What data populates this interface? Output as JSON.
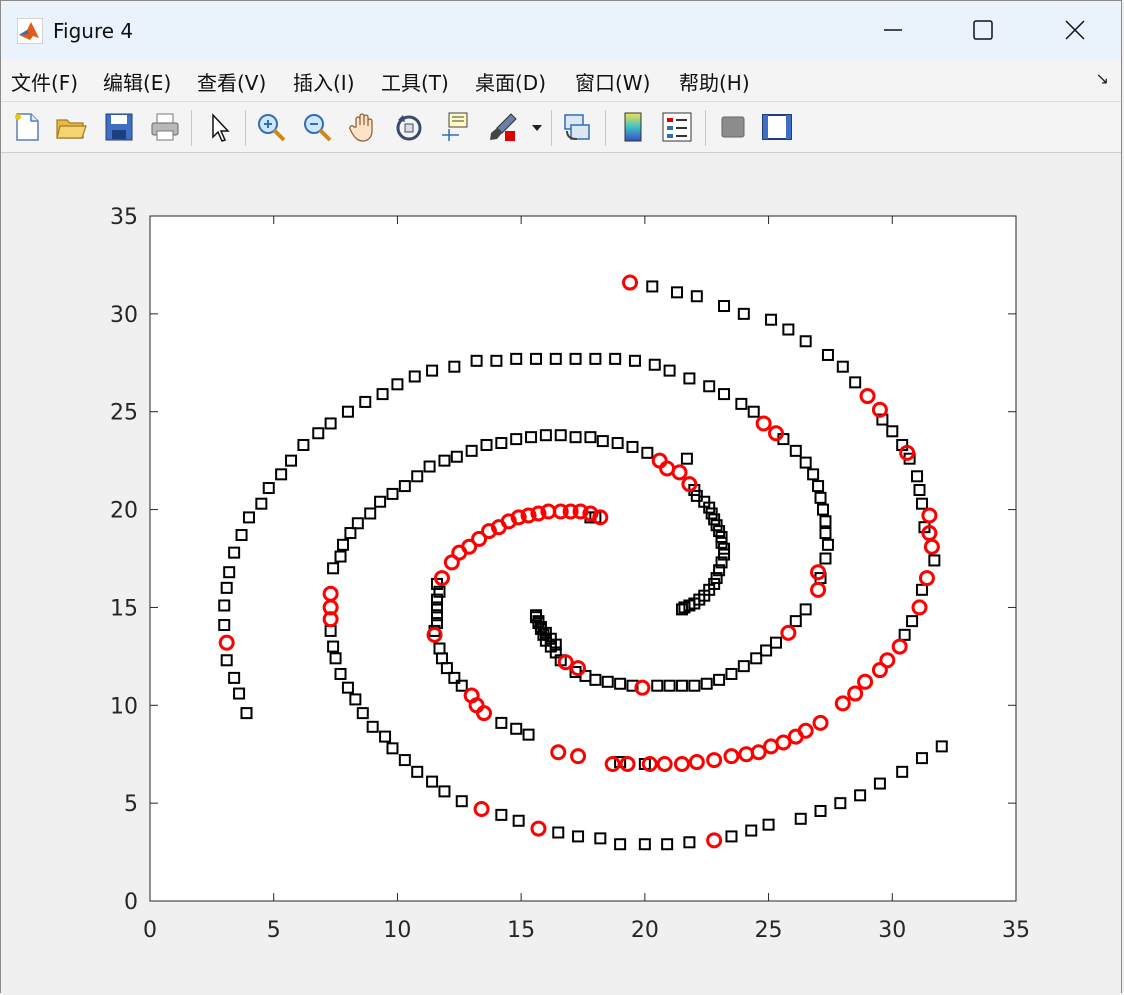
{
  "window": {
    "title": "Figure 4",
    "colors": {
      "titlebar": "#eaf3fb",
      "background": "#f0f0f0"
    }
  },
  "menu": {
    "items": [
      "文件(F)",
      "编辑(E)",
      "查看(V)",
      "插入(I)",
      "工具(T)",
      "桌面(D)",
      "窗口(W)",
      "帮助(H)"
    ],
    "overflow_glyph": "↘"
  },
  "toolbar": {
    "buttons": [
      "new-figure-icon",
      "open-file-icon",
      "save-icon",
      "print-icon",
      "edit-plot-arrow-icon",
      "zoom-in-icon",
      "zoom-out-icon",
      "pan-hand-icon",
      "rotate-3d-icon",
      "data-cursor-icon",
      "brush-icon",
      "link-plot-icon",
      "insert-colorbar-icon",
      "insert-legend-icon",
      "hide-plot-tools-icon",
      "show-plot-tools-icon"
    ]
  },
  "chart_data": {
    "type": "scatter",
    "title": "",
    "xlabel": "",
    "ylabel": "",
    "xlim": [
      0,
      35
    ],
    "ylim": [
      0,
      35
    ],
    "xticks": [
      "0",
      "5",
      "10",
      "15",
      "20",
      "25",
      "30",
      "35"
    ],
    "yticks": [
      "0",
      "5",
      "10",
      "15",
      "20",
      "25",
      "30",
      "35"
    ],
    "grid": false,
    "series": [
      {
        "marker": "square",
        "color": "#000000",
        "points": [
          [
            3.9,
            9.6
          ],
          [
            3.6,
            10.6
          ],
          [
            3.4,
            11.4
          ],
          [
            3.1,
            12.3
          ],
          [
            3.0,
            14.1
          ],
          [
            3.0,
            15.1
          ],
          [
            3.1,
            16.0
          ],
          [
            3.2,
            16.8
          ],
          [
            3.4,
            17.8
          ],
          [
            3.7,
            18.7
          ],
          [
            4.0,
            19.6
          ],
          [
            4.5,
            20.3
          ],
          [
            4.8,
            21.1
          ],
          [
            5.3,
            21.8
          ],
          [
            5.7,
            22.5
          ],
          [
            6.2,
            23.3
          ],
          [
            6.8,
            23.9
          ],
          [
            7.3,
            24.4
          ],
          [
            8.0,
            25.0
          ],
          [
            8.7,
            25.5
          ],
          [
            9.4,
            25.9
          ],
          [
            10.0,
            26.4
          ],
          [
            10.7,
            26.8
          ],
          [
            11.4,
            27.1
          ],
          [
            12.3,
            27.3
          ],
          [
            13.2,
            27.6
          ],
          [
            14.0,
            27.6
          ],
          [
            14.8,
            27.7
          ],
          [
            15.6,
            27.7
          ],
          [
            16.4,
            27.7
          ],
          [
            17.2,
            27.7
          ],
          [
            18.0,
            27.7
          ],
          [
            18.8,
            27.7
          ],
          [
            19.6,
            27.6
          ],
          [
            20.4,
            27.4
          ],
          [
            21.0,
            27.1
          ],
          [
            21.8,
            26.7
          ],
          [
            22.6,
            26.3
          ],
          [
            23.2,
            25.9
          ],
          [
            23.9,
            25.4
          ],
          [
            24.4,
            25.0
          ],
          [
            25.6,
            23.6
          ],
          [
            26.1,
            23.0
          ],
          [
            26.5,
            22.4
          ],
          [
            26.8,
            21.8
          ],
          [
            27.0,
            21.2
          ],
          [
            27.1,
            20.6
          ],
          [
            27.2,
            20.0
          ],
          [
            27.3,
            19.4
          ],
          [
            27.3,
            18.8
          ],
          [
            27.4,
            18.2
          ],
          [
            27.3,
            17.5
          ],
          [
            27.1,
            16.5
          ],
          [
            26.5,
            14.9
          ],
          [
            26.1,
            14.3
          ],
          [
            25.3,
            13.2
          ],
          [
            24.9,
            12.8
          ],
          [
            24.5,
            12.4
          ],
          [
            24.0,
            12.0
          ],
          [
            23.5,
            11.6
          ],
          [
            23.0,
            11.3
          ],
          [
            22.5,
            11.1
          ],
          [
            22.0,
            11.0
          ],
          [
            21.5,
            11.0
          ],
          [
            21.0,
            11.0
          ],
          [
            20.5,
            11.0
          ],
          [
            19.5,
            11.0
          ],
          [
            19.0,
            11.1
          ],
          [
            18.5,
            11.2
          ],
          [
            18.0,
            11.3
          ],
          [
            17.6,
            11.5
          ],
          [
            17.2,
            11.7
          ],
          [
            16.6,
            12.3
          ],
          [
            16.4,
            12.7
          ],
          [
            16.2,
            13.0
          ],
          [
            16.0,
            13.3
          ],
          [
            15.9,
            13.6
          ],
          [
            15.8,
            13.9
          ],
          [
            15.7,
            14.2
          ],
          [
            15.6,
            14.5
          ],
          [
            15.6,
            14.6
          ],
          [
            15.7,
            14.3
          ],
          [
            15.8,
            14.0
          ],
          [
            16.0,
            13.7
          ],
          [
            16.2,
            13.4
          ],
          [
            16.4,
            13.1
          ],
          [
            7.3,
            13.8
          ],
          [
            7.4,
            13.0
          ],
          [
            7.5,
            12.4
          ],
          [
            7.7,
            11.6
          ],
          [
            8.0,
            10.9
          ],
          [
            8.3,
            10.3
          ],
          [
            8.6,
            9.6
          ],
          [
            9.0,
            8.9
          ],
          [
            9.5,
            8.4
          ],
          [
            9.8,
            7.8
          ],
          [
            10.3,
            7.2
          ],
          [
            10.8,
            6.6
          ],
          [
            11.4,
            6.1
          ],
          [
            11.9,
            5.6
          ],
          [
            12.6,
            5.1
          ],
          [
            14.2,
            4.4
          ],
          [
            14.9,
            4.1
          ],
          [
            16.5,
            3.5
          ],
          [
            17.3,
            3.3
          ],
          [
            18.2,
            3.2
          ],
          [
            19.0,
            2.9
          ],
          [
            20.0,
            2.9
          ],
          [
            20.9,
            2.9
          ],
          [
            21.8,
            3.0
          ],
          [
            23.5,
            3.3
          ],
          [
            24.3,
            3.6
          ],
          [
            25.0,
            3.9
          ],
          [
            26.3,
            4.2
          ],
          [
            27.1,
            4.6
          ],
          [
            27.9,
            5.0
          ],
          [
            28.7,
            5.4
          ],
          [
            29.5,
            6.0
          ],
          [
            30.4,
            6.6
          ],
          [
            31.2,
            7.3
          ],
          [
            32.0,
            7.9
          ],
          [
            30.8,
            14.3
          ],
          [
            30.5,
            13.6
          ],
          [
            31.2,
            15.9
          ],
          [
            31.7,
            17.4
          ],
          [
            31.3,
            19.1
          ],
          [
            31.2,
            20.3
          ],
          [
            31.1,
            21.0
          ],
          [
            31.0,
            21.7
          ],
          [
            30.7,
            22.6
          ],
          [
            30.4,
            23.3
          ],
          [
            30.0,
            24.0
          ],
          [
            29.6,
            24.6
          ],
          [
            28.5,
            26.5
          ],
          [
            28.0,
            27.3
          ],
          [
            27.4,
            27.9
          ],
          [
            26.5,
            28.6
          ],
          [
            25.8,
            29.2
          ],
          [
            25.1,
            29.7
          ],
          [
            24.0,
            30.0
          ],
          [
            23.2,
            30.4
          ],
          [
            22.1,
            30.9
          ],
          [
            21.3,
            31.1
          ],
          [
            20.3,
            31.4
          ],
          [
            7.4,
            17.0
          ],
          [
            7.7,
            17.6
          ],
          [
            7.8,
            18.2
          ],
          [
            8.1,
            18.8
          ],
          [
            8.4,
            19.3
          ],
          [
            8.9,
            19.8
          ],
          [
            9.3,
            20.4
          ],
          [
            9.8,
            20.8
          ],
          [
            10.3,
            21.2
          ],
          [
            10.8,
            21.7
          ],
          [
            11.3,
            22.2
          ],
          [
            11.9,
            22.5
          ],
          [
            12.4,
            22.7
          ],
          [
            13.0,
            23.0
          ],
          [
            13.6,
            23.3
          ],
          [
            14.2,
            23.4
          ],
          [
            14.8,
            23.6
          ],
          [
            15.4,
            23.7
          ],
          [
            16.0,
            23.8
          ],
          [
            16.6,
            23.8
          ],
          [
            17.2,
            23.7
          ],
          [
            17.8,
            23.7
          ],
          [
            18.3,
            23.5
          ],
          [
            18.9,
            23.4
          ],
          [
            19.5,
            23.2
          ],
          [
            20.1,
            22.9
          ],
          [
            21.7,
            22.6
          ],
          [
            22.0,
            21.0
          ],
          [
            22.1,
            20.7
          ],
          [
            22.4,
            20.4
          ],
          [
            22.6,
            20.1
          ],
          [
            22.7,
            19.8
          ],
          [
            22.8,
            19.5
          ],
          [
            22.9,
            19.2
          ],
          [
            23.0,
            18.9
          ],
          [
            23.1,
            18.6
          ],
          [
            23.1,
            18.3
          ],
          [
            23.2,
            18.0
          ],
          [
            23.2,
            17.7
          ],
          [
            23.1,
            17.3
          ],
          [
            23.0,
            16.9
          ],
          [
            22.9,
            16.5
          ],
          [
            22.8,
            16.2
          ],
          [
            22.6,
            15.9
          ],
          [
            22.4,
            15.6
          ],
          [
            22.2,
            15.4
          ],
          [
            22.0,
            15.2
          ],
          [
            21.8,
            15.1
          ],
          [
            21.6,
            15.0
          ],
          [
            21.5,
            14.9
          ],
          [
            17.8,
            19.6
          ],
          [
            18.0,
            19.6
          ],
          [
            11.6,
            14.2
          ],
          [
            11.6,
            14.6
          ],
          [
            11.6,
            15.0
          ],
          [
            11.6,
            15.4
          ],
          [
            11.7,
            15.8
          ],
          [
            11.6,
            16.2
          ],
          [
            11.5,
            13.8
          ],
          [
            11.7,
            12.9
          ],
          [
            11.8,
            12.4
          ],
          [
            12.0,
            11.9
          ],
          [
            12.3,
            11.4
          ],
          [
            12.6,
            11.0
          ],
          [
            14.2,
            9.1
          ],
          [
            14.8,
            8.8
          ],
          [
            15.3,
            8.5
          ],
          [
            19.0,
            7.1
          ],
          [
            20.0,
            7.0
          ]
        ]
      },
      {
        "marker": "circle",
        "color": "#ff0000",
        "points": [
          [
            3.1,
            13.2
          ],
          [
            7.3,
            15.7
          ],
          [
            7.3,
            15.0
          ],
          [
            7.3,
            14.4
          ],
          [
            11.5,
            13.6
          ],
          [
            11.8,
            16.5
          ],
          [
            12.2,
            17.3
          ],
          [
            12.5,
            17.8
          ],
          [
            12.9,
            18.1
          ],
          [
            13.3,
            18.5
          ],
          [
            13.7,
            18.9
          ],
          [
            14.1,
            19.1
          ],
          [
            14.5,
            19.4
          ],
          [
            14.9,
            19.6
          ],
          [
            15.3,
            19.7
          ],
          [
            15.7,
            19.8
          ],
          [
            16.1,
            19.9
          ],
          [
            16.6,
            19.9
          ],
          [
            17.0,
            19.9
          ],
          [
            17.4,
            19.9
          ],
          [
            17.8,
            19.8
          ],
          [
            18.2,
            19.6
          ],
          [
            19.4,
            31.6
          ],
          [
            20.6,
            22.5
          ],
          [
            20.9,
            22.1
          ],
          [
            21.4,
            21.9
          ],
          [
            21.8,
            21.3
          ],
          [
            24.8,
            24.4
          ],
          [
            25.3,
            23.9
          ],
          [
            29.0,
            25.8
          ],
          [
            29.5,
            25.1
          ],
          [
            30.6,
            22.9
          ],
          [
            31.5,
            19.7
          ],
          [
            31.5,
            18.8
          ],
          [
            31.6,
            18.1
          ],
          [
            31.4,
            16.5
          ],
          [
            31.1,
            15.0
          ],
          [
            30.3,
            13.0
          ],
          [
            29.8,
            12.3
          ],
          [
            29.5,
            11.8
          ],
          [
            28.9,
            11.2
          ],
          [
            28.5,
            10.6
          ],
          [
            28.0,
            10.1
          ],
          [
            27.1,
            9.1
          ],
          [
            26.5,
            8.7
          ],
          [
            26.1,
            8.4
          ],
          [
            25.6,
            8.1
          ],
          [
            25.1,
            7.9
          ],
          [
            24.6,
            7.6
          ],
          [
            24.1,
            7.5
          ],
          [
            23.5,
            7.4
          ],
          [
            22.8,
            7.2
          ],
          [
            22.1,
            7.1
          ],
          [
            21.5,
            7.0
          ],
          [
            20.8,
            7.0
          ],
          [
            20.2,
            7.0
          ],
          [
            19.3,
            7.0
          ],
          [
            18.7,
            7.0
          ],
          [
            17.3,
            7.4
          ],
          [
            16.5,
            7.6
          ],
          [
            13.0,
            10.5
          ],
          [
            13.2,
            10.0
          ],
          [
            13.5,
            9.6
          ],
          [
            22.8,
            3.1
          ],
          [
            15.7,
            3.7
          ],
          [
            13.4,
            4.7
          ],
          [
            16.8,
            12.2
          ],
          [
            17.3,
            11.9
          ],
          [
            19.9,
            10.9
          ],
          [
            25.8,
            13.7
          ],
          [
            27.0,
            15.9
          ],
          [
            27.0,
            16.8
          ]
        ]
      }
    ]
  }
}
